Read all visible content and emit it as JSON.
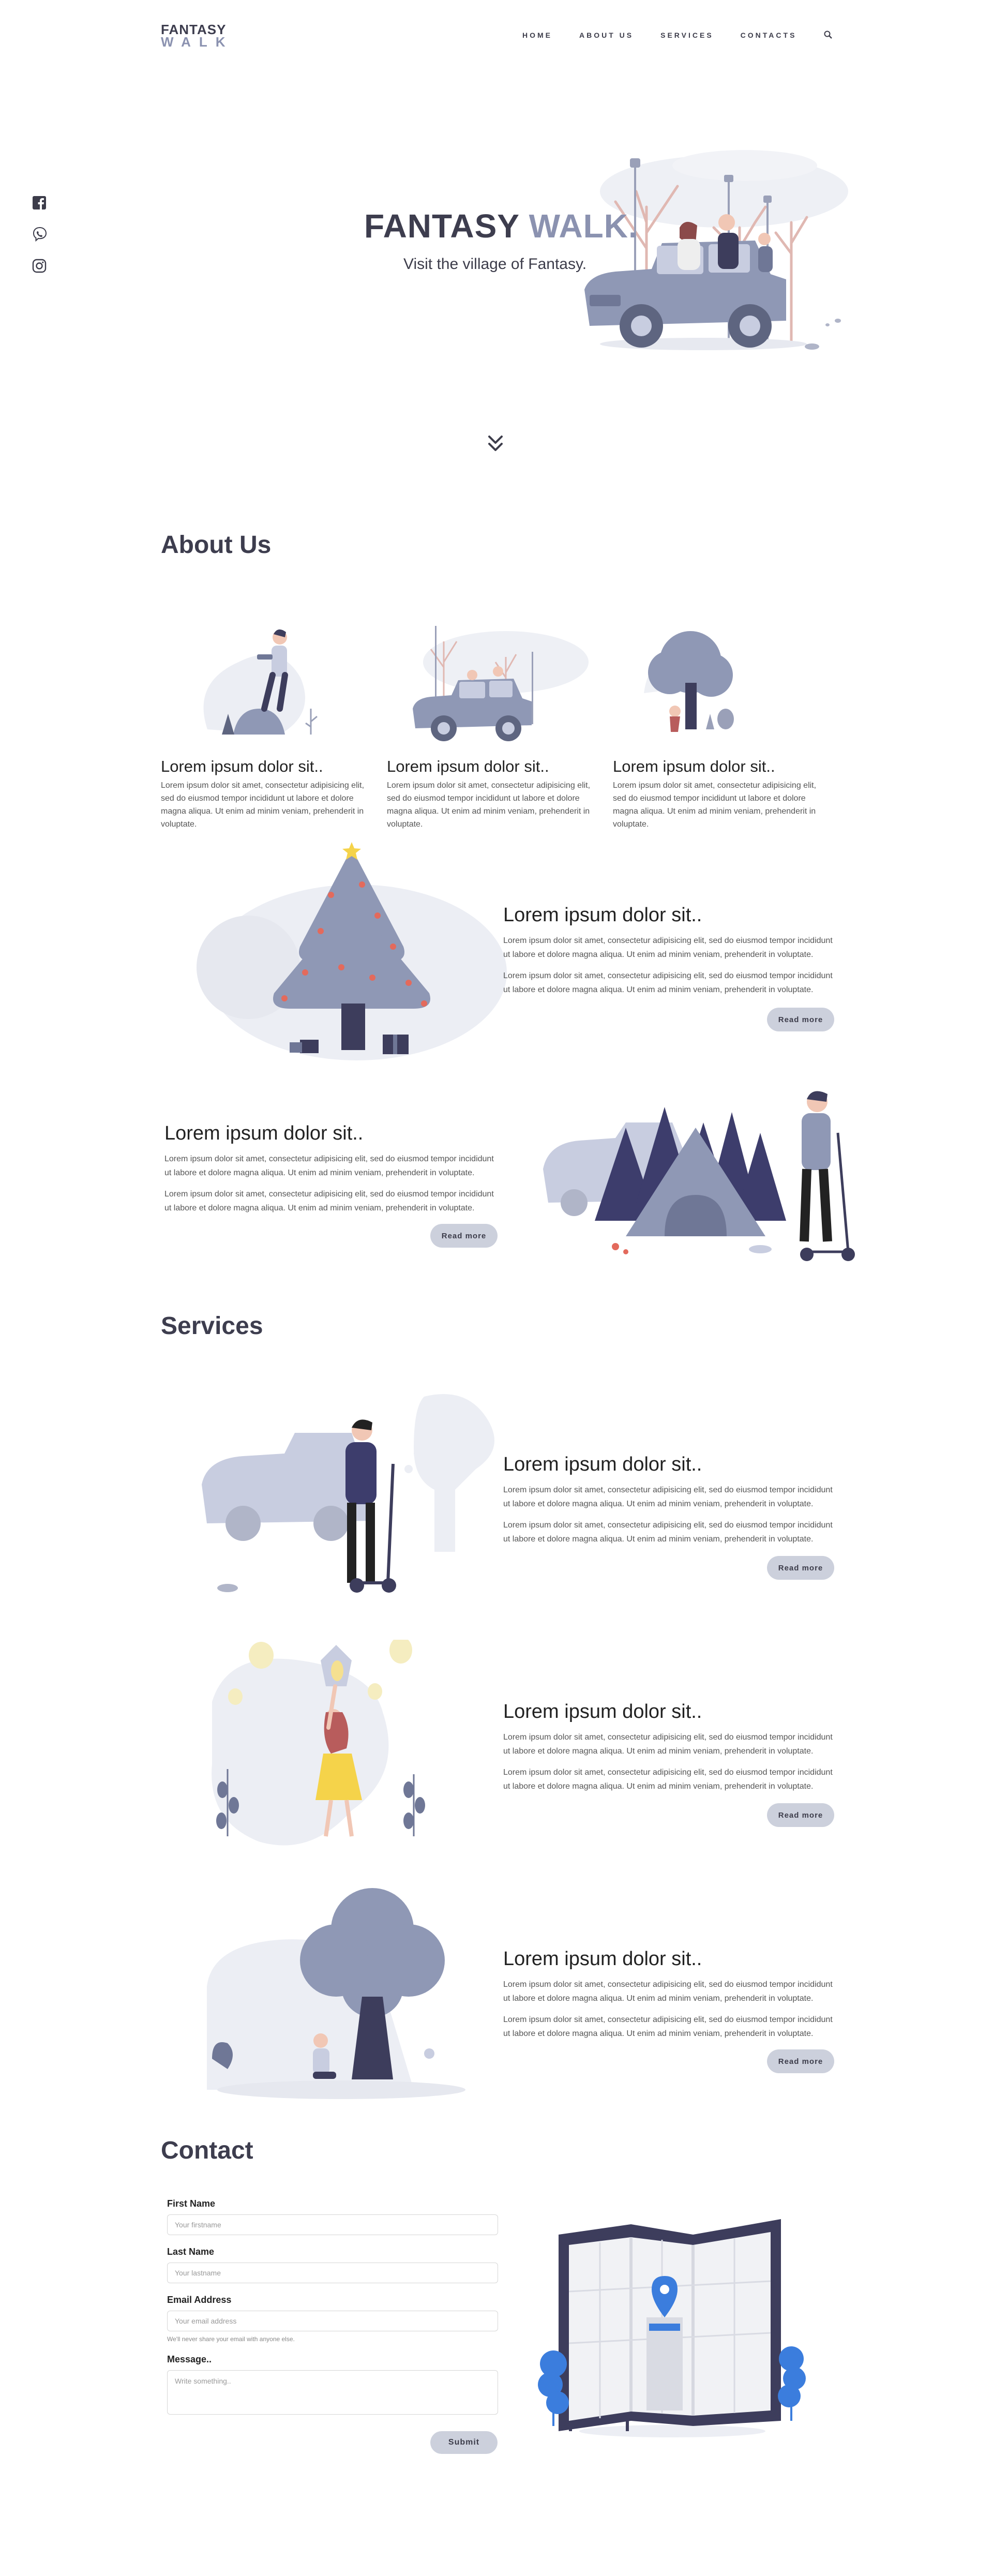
{
  "header": {
    "logo_line1": "FANTASY",
    "logo_line2": "WALK",
    "nav": [
      "HOME",
      "ABOUT US",
      "SERVICES",
      "CONTACTS"
    ]
  },
  "social": [
    "facebook-icon",
    "viber-icon",
    "instagram-icon"
  ],
  "hero": {
    "title_main": "FANTASY ",
    "title_accent": "WALK.",
    "subtitle": "Visit the village of Fantasy."
  },
  "about": {
    "heading": "About Us",
    "cards": [
      {
        "title": "Lorem ipsum dolor sit..",
        "text": "Lorem ipsum dolor sit amet, consectetur adipisicing elit, sed do eiusmod tempor incididunt ut labore et dolore magna aliqua. Ut enim ad minim veniam, prehenderit in voluptate."
      },
      {
        "title": "Lorem ipsum dolor sit..",
        "text": "Lorem ipsum dolor sit amet, consectetur adipisicing elit, sed do eiusmod tempor incididunt ut labore et dolore magna aliqua. Ut enim ad minim veniam, prehenderit in voluptate."
      },
      {
        "title": "Lorem ipsum dolor sit..",
        "text": "Lorem ipsum dolor sit amet, consectetur adipisicing elit, sed do eiusmod tempor incididunt ut labore et dolore magna aliqua. Ut enim ad minim veniam, prehenderit in voluptate."
      }
    ],
    "features": [
      {
        "title": "Lorem ipsum dolor sit..",
        "p1": "Lorem ipsum dolor sit amet, consectetur adipisicing elit, sed do eiusmod tempor incididunt ut labore et dolore magna aliqua. Ut enim ad minim veniam, prehenderit in voluptate.",
        "p2": "Lorem ipsum dolor sit amet, consectetur adipisicing elit, sed do eiusmod tempor incididunt ut labore et dolore magna aliqua. Ut enim ad minim veniam, prehenderit in voluptate.",
        "button": "Read more"
      },
      {
        "title": "Lorem ipsum dolor sit..",
        "p1": "Lorem ipsum dolor sit amet, consectetur adipisicing elit, sed do eiusmod tempor incididunt ut labore et dolore magna aliqua. Ut enim ad minim veniam, prehenderit in voluptate.",
        "p2": "Lorem ipsum dolor sit amet, consectetur adipisicing elit, sed do eiusmod tempor incididunt ut labore et dolore magna aliqua. Ut enim ad minim veniam, prehenderit in voluptate.",
        "button": "Read more"
      }
    ]
  },
  "services": {
    "heading": "Services",
    "items": [
      {
        "title": "Lorem ipsum dolor sit..",
        "p1": "Lorem ipsum dolor sit amet, consectetur adipisicing elit, sed do eiusmod tempor incididunt ut labore et dolore magna aliqua. Ut enim ad minim veniam, prehenderit in voluptate.",
        "p2": "Lorem ipsum dolor sit amet, consectetur adipisicing elit, sed do eiusmod tempor incididunt ut labore et dolore magna aliqua. Ut enim ad minim veniam, prehenderit in voluptate.",
        "button": "Read more"
      },
      {
        "title": "Lorem ipsum dolor sit..",
        "p1": "Lorem ipsum dolor sit amet, consectetur adipisicing elit, sed do eiusmod tempor incididunt ut labore et dolore magna aliqua. Ut enim ad minim veniam, prehenderit in voluptate.",
        "p2": "Lorem ipsum dolor sit amet, consectetur adipisicing elit, sed do eiusmod tempor incididunt ut labore et dolore magna aliqua. Ut enim ad minim veniam, prehenderit in voluptate.",
        "button": "Read more"
      },
      {
        "title": "Lorem ipsum dolor sit..",
        "p1": "Lorem ipsum dolor sit amet, consectetur adipisicing elit, sed do eiusmod tempor incididunt ut labore et dolore magna aliqua. Ut enim ad minim veniam, prehenderit in voluptate.",
        "p2": "Lorem ipsum dolor sit amet, consectetur adipisicing elit, sed do eiusmod tempor incididunt ut labore et dolore magna aliqua. Ut enim ad minim veniam, prehenderit in voluptate.",
        "button": "Read more"
      }
    ]
  },
  "contact": {
    "heading": "Contact",
    "first_name_label": "First Name",
    "first_name_placeholder": "Your firstname",
    "last_name_label": "Last Name",
    "last_name_placeholder": "Your lastname",
    "email_label": "Email Address",
    "email_placeholder": "Your email address",
    "email_help": "We'll never share your email with anyone else.",
    "message_label": "Message..",
    "message_placeholder": "Write something..",
    "submit": "Submit"
  },
  "colors": {
    "dark": "#3d3d4e",
    "accent": "#8b92b0",
    "button": "#ccd0dc",
    "map_blue": "#3b7ddd"
  }
}
